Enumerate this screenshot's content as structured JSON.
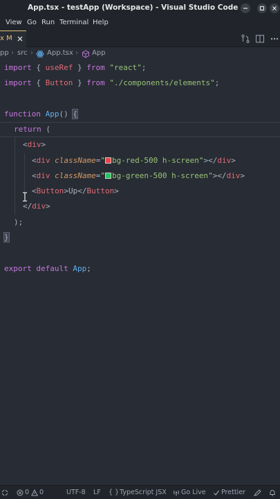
{
  "window": {
    "title": "App.tsx - testApp (Workspace) - Visual Studio Code"
  },
  "menu": {
    "items": [
      "View",
      "Go",
      "Run",
      "Terminal",
      "Help"
    ]
  },
  "tab": {
    "label": "x M"
  },
  "breadcrumb": {
    "items": [
      "pp",
      "src",
      "App.tsx",
      "App"
    ]
  },
  "editor": {
    "colors": {
      "keyword": "#c678dd",
      "identifier": "#e06c75",
      "string": "#98c379",
      "function": "#61afef",
      "attribute": "#d19a66",
      "red_swatch": "#ef4444",
      "green_swatch": "#22c55e"
    },
    "tokens": {
      "import": "import",
      "from": "from",
      "function": "function",
      "return": "return",
      "export": "export",
      "default": "default",
      "useRef": "useRef",
      "Button": "Button",
      "react": "\"react\"",
      "elements_path": "\"./components/elements\"",
      "App": "App",
      "div": "div",
      "className": "className",
      "red_class": "bg-red-500 h-screen",
      "green_class": "bg-green-500 h-screen",
      "button_text": "Up"
    }
  },
  "statusbar": {
    "errors": "0",
    "warnings": "0",
    "encoding": "UTF-8",
    "eol": "LF",
    "language": "TypeScript JSX",
    "golive": "Go Live",
    "prettier": "Prettier"
  }
}
